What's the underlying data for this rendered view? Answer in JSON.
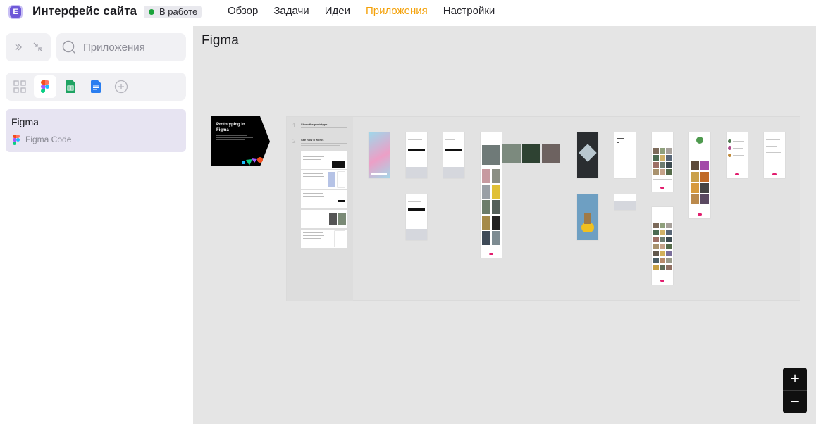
{
  "header": {
    "logo_letter": "E",
    "project_title": "Интерфейс сайта",
    "status": "В работе",
    "status_color": "#1aa33a",
    "tabs": [
      {
        "label": "Обзор",
        "active": false
      },
      {
        "label": "Задачи",
        "active": false
      },
      {
        "label": "Идеи",
        "active": false
      },
      {
        "label": "Приложения",
        "active": true
      },
      {
        "label": "Настройки",
        "active": false
      }
    ],
    "accent_color": "#f4a20b"
  },
  "sidebar": {
    "search": {
      "placeholder": "Приложения",
      "value": ""
    },
    "filters": [
      "grid-icon",
      "figma-icon",
      "sheets-icon",
      "docs-icon",
      "add-icon"
    ],
    "active_filter": "figma-icon",
    "apps": [
      {
        "name": "Figma",
        "subtitle": "Figma Code",
        "icon": "figma-icon"
      }
    ]
  },
  "canvas": {
    "title": "Figma",
    "cover_text": "Prototyping in Figma",
    "board_side": {
      "step1": "1",
      "step1_title": "Show the prototype",
      "step2": "2",
      "step2_title": "See how it works"
    },
    "zoom": {
      "in": "+",
      "out": "−"
    }
  }
}
